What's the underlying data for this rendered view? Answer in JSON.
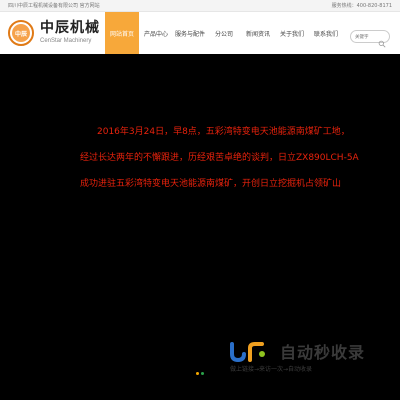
{
  "topbar": {
    "company": "四川中辰工程机械设备有限公司 官方网站",
    "phone": "服务热线：400-820-8171"
  },
  "logo": {
    "mark_text": "中辰"
  },
  "brand": {
    "name_cn": "中辰机械",
    "name_en": "CenStar Machinery"
  },
  "nav": {
    "items": [
      {
        "label": "网站首页",
        "active": true
      },
      {
        "label": "产品中心",
        "active": false
      },
      {
        "label": "服务与配件",
        "active": false
      },
      {
        "label": "分公司",
        "active": false
      },
      {
        "label": "新闻资讯",
        "active": false
      },
      {
        "label": "关于我们",
        "active": false
      },
      {
        "label": "联系我们",
        "active": false
      }
    ]
  },
  "search": {
    "placeholder": "关键字",
    "icon": "search-icon"
  },
  "banner": {
    "lines": [
      "2016年3月24日，早8点，五彩湾特变电天池能源南煤矿工地，",
      "经过长达两年的不懈跟进，历经艰苦卓绝的谈判，日立ZX890LCH-5A",
      "成功进驻五彩湾特变电天池能源南煤矿，开创日立挖掘机占领矿山"
    ],
    "text_color": "#e8220c",
    "slider_dots": [
      {
        "color": "#f6a800"
      },
      {
        "color": "#2aa24a"
      }
    ]
  },
  "watermark": {
    "title": "自动秒收录",
    "subtitle": "做上链接→来访一次→自动收录"
  },
  "colors": {
    "accent": "#f7a83a",
    "logo_orange": "#e07a16",
    "background": "#000000"
  }
}
